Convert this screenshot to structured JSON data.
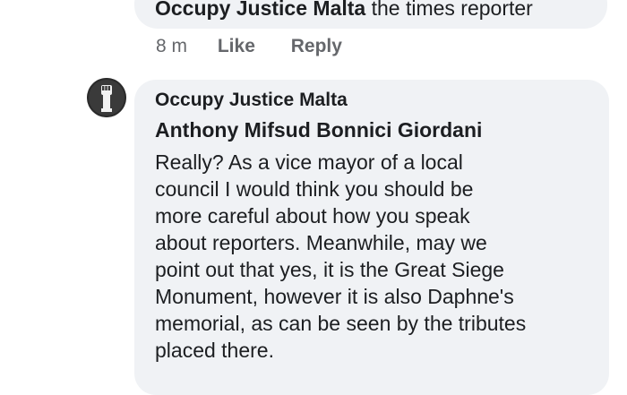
{
  "previous_comment": {
    "author": "Occupy Justice Malta",
    "text": "the times reporter",
    "time": "8 m",
    "like_label": "Like",
    "reply_label": "Reply"
  },
  "comment": {
    "avatar_icon": "raised-fist-icon",
    "author": "Occupy Justice Malta",
    "mention": "Anthony Mifsud Bonnici Giordani",
    "lines": [
      "Really?  As a vice mayor of a local",
      "council I would think you should be",
      "more careful about how you speak",
      "about reporters.  Meanwhile, may we",
      "point out that yes, it is the Great Siege",
      "Monument, however it is also Daphne's",
      "memorial, as can be seen by the tributes",
      "placed there."
    ]
  },
  "colors": {
    "bubble": "#f0f2f5",
    "text": "#1c1e21",
    "meta": "#65676b"
  }
}
